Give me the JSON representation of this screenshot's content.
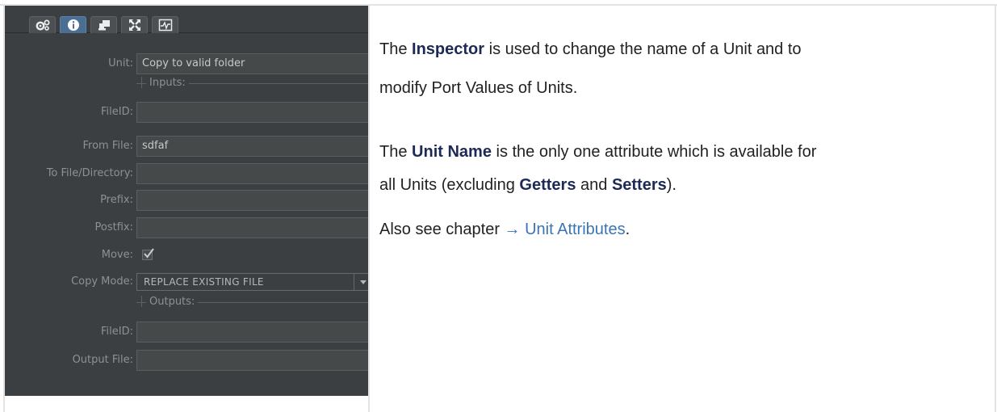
{
  "inspector": {
    "tabs": [
      {
        "icon": "gears-icon"
      },
      {
        "icon": "info-icon",
        "active": true
      },
      {
        "icon": "stamp-icon"
      },
      {
        "icon": "expand-icon"
      },
      {
        "icon": "chart-window-icon"
      }
    ],
    "unit": {
      "label": "Unit:",
      "value": "Copy to valid folder"
    },
    "inputs_title": "Inputs:",
    "inputs": {
      "file_id": {
        "label": "FileID:",
        "value": ""
      },
      "from_file": {
        "label": "From File:",
        "value": "sdfaf"
      },
      "to_file": {
        "label": "To File/Directory:",
        "value": ""
      },
      "prefix": {
        "label": "Prefix:",
        "value": ""
      },
      "postfix": {
        "label": "Postfix:",
        "value": ""
      },
      "move": {
        "label": "Move:",
        "checked": true
      },
      "copy_mode": {
        "label": "Copy Mode:",
        "value": "REPLACE EXISTING FILE"
      }
    },
    "outputs_title": "Outputs:",
    "outputs": {
      "file_id": {
        "label": "FileID:",
        "value": ""
      },
      "output_file": {
        "label": "Output File:",
        "value": ""
      }
    },
    "colors": {
      "panel_bg": "#3c3f41",
      "active_tab": "#4a6f93"
    }
  },
  "doc": {
    "p1": {
      "a": "The ",
      "b": "Inspector",
      "c": " is used to change the name of a Unit and to",
      "d": "modify Port Values of Units."
    },
    "p2": {
      "a": "The ",
      "b": "Unit Name",
      "c": " is the only one attribute which is available for",
      "d": "all Units (excluding ",
      "e": "Getters",
      "f": " and ",
      "g": "Setters",
      "h": ")."
    },
    "p3": {
      "a": "Also see chapter ",
      "link": "→ Unit Attributes",
      "b": "."
    },
    "colors": {
      "bold": "#1c2a55",
      "link": "#3b74b4"
    }
  }
}
